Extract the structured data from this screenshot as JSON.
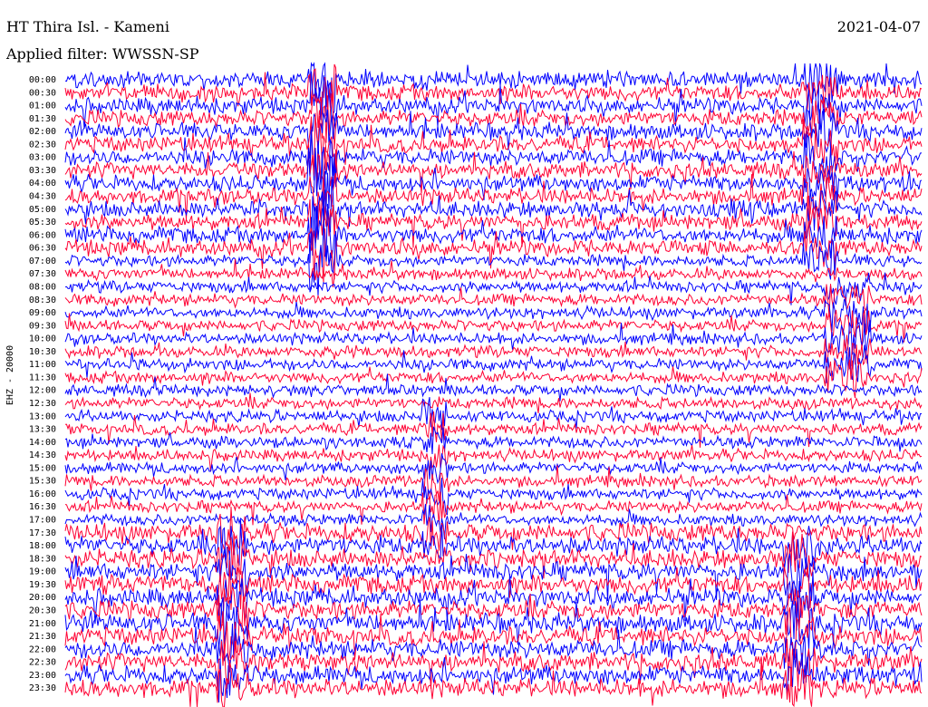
{
  "header": {
    "station": "HT Thira Isl. - Kameni",
    "filter": "Applied filter: WWSSN-SP",
    "date": "2021-04-07"
  },
  "chart_data": {
    "type": "line",
    "kind": "helicorder",
    "ylabel": "EHZ - 20000",
    "row_labels": [
      "00:00",
      "00:30",
      "01:00",
      "01:30",
      "02:00",
      "02:30",
      "03:00",
      "03:30",
      "04:00",
      "04:30",
      "05:00",
      "05:30",
      "06:00",
      "06:30",
      "07:00",
      "07:30",
      "08:00",
      "08:30",
      "09:00",
      "09:30",
      "10:00",
      "10:30",
      "11:00",
      "11:30",
      "12:00",
      "12:30",
      "13:00",
      "13:30",
      "14:00",
      "14:30",
      "15:00",
      "15:30",
      "16:00",
      "16:30",
      "17:00",
      "17:30",
      "18:00",
      "18:30",
      "19:00",
      "19:30",
      "20:00",
      "20:30",
      "21:00",
      "21:30",
      "22:00",
      "22:30",
      "23:00",
      "23:30"
    ],
    "trace_colors": [
      "#0000ff",
      "#ff0033"
    ],
    "grid": false,
    "legend": "none"
  }
}
